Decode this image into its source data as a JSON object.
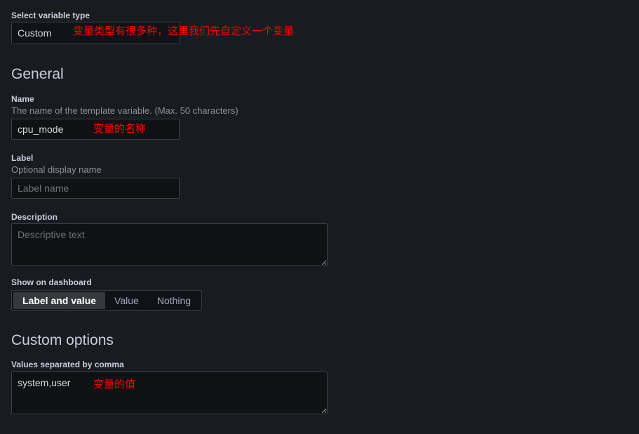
{
  "variable_type": {
    "label": "Select variable type",
    "selected": "Custom",
    "annotation": "变量类型有很多种，这里我们先自定义一个变量"
  },
  "general": {
    "heading": "General",
    "name": {
      "label": "Name",
      "description": "The name of the template variable. (Max. 50 characters)",
      "value": "cpu_mode",
      "annotation": "变量的名称"
    },
    "label_field": {
      "label": "Label",
      "description": "Optional display name",
      "value": "",
      "placeholder": "Label name"
    },
    "description_field": {
      "label": "Description",
      "value": "",
      "placeholder": "Descriptive text"
    },
    "show_on_dashboard": {
      "label": "Show on dashboard",
      "options": [
        "Label and value",
        "Value",
        "Nothing"
      ],
      "selected": "Label and value"
    }
  },
  "custom_options": {
    "heading": "Custom options",
    "values": {
      "label": "Values separated by comma",
      "value": "system,user",
      "annotation": "变量的值"
    }
  },
  "colors": {
    "page_background": "#181b1f",
    "input_background": "#0f1114",
    "border": "#3a3f47",
    "text_primary": "#d8d9da",
    "text_secondary": "#8e9297",
    "annotation_red": "#ff0000",
    "radio_active_background": "#35393e"
  }
}
